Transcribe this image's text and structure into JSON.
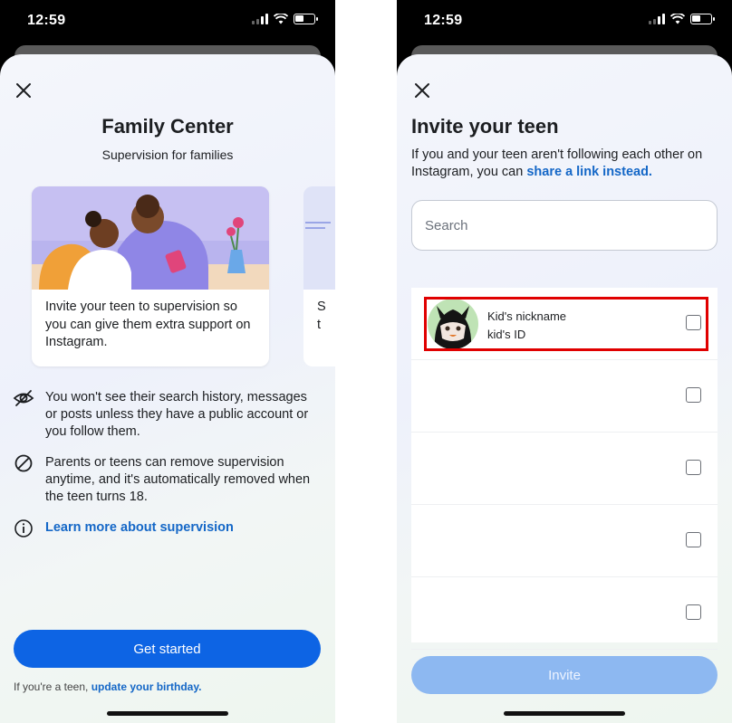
{
  "status_bar": {
    "time": "12:59"
  },
  "family_center": {
    "title": "Family Center",
    "subtitle": "Supervision for families",
    "card_text": "Invite your teen to supervision so you can give them extra support on Instagram.",
    "next_card_peek_line1": "S",
    "next_card_peek_line2": "t",
    "info_items": [
      {
        "icon": "eye-off-icon",
        "text": "You won't see their search history, messages or posts unless they have a public account or you follow them."
      },
      {
        "icon": "block-icon",
        "text": "Parents or teens can remove supervision anytime, and it's automatically removed when the teen turns 18."
      },
      {
        "icon": "info-icon",
        "text": "Learn more about supervision"
      }
    ],
    "primary_button": "Get started",
    "teen_note_prefix": "If you're a teen, ",
    "teen_note_link": "update your birthday."
  },
  "invite": {
    "title": "Invite your teen",
    "description_prefix": "If you and your teen aren't following each other on Instagram, you can ",
    "description_link": "share a link instead.",
    "search_placeholder": "Search",
    "rows": [
      {
        "nickname": "Kid's nickname",
        "id": "kid's ID",
        "checked": false
      },
      {
        "nickname": "",
        "id": "",
        "checked": false
      },
      {
        "nickname": "",
        "id": "",
        "checked": false
      },
      {
        "nickname": "",
        "id": "",
        "checked": false
      },
      {
        "nickname": "",
        "id": "",
        "checked": false
      }
    ],
    "invite_button": "Invite"
  },
  "colors": {
    "primary_blue": "#0d64e4",
    "link_blue": "#1467c7",
    "disabled_blue": "#8db8f1",
    "highlight_red": "#e00000"
  }
}
